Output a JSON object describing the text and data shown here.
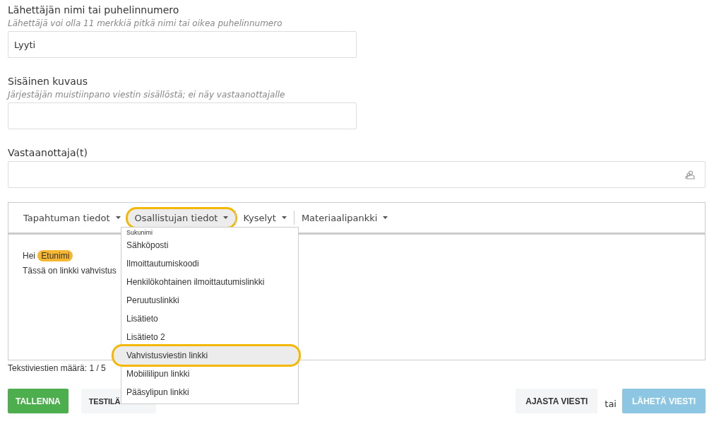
{
  "sender": {
    "label": "Lähettäjän nimi tai puhelinnumero",
    "hint": "Lähettäjä voi olla 11 merkkiä pitkä nimi tai oikea puhelinnumero",
    "value": "Lyyti"
  },
  "description": {
    "label": "Sisäinen kuvaus",
    "hint": "Järjestäjän muistiinpano viestin sisällöstä; ei näy vastaanottajalle"
  },
  "recipients": {
    "label": "Vastaanottaja(t)"
  },
  "toolbar": [
    {
      "label": "Tapahtuman tiedot",
      "selected": false
    },
    {
      "label": "Osallistujan tiedot",
      "selected": true
    },
    {
      "label": "Kyselyt",
      "selected": false
    },
    {
      "label": "Materiaalipankki",
      "selected": false
    }
  ],
  "message": {
    "greeting": "Hei",
    "tag": "Etunimi",
    "line_2": "Tässä on linkki vahvistus"
  },
  "counter": "Tekstiviestien määrä: 1 / 5",
  "menu": [
    {
      "label": "Sukunimi",
      "selected": false
    },
    {
      "label": "Sähköposti",
      "selected": false
    },
    {
      "label": "Ilmoittautumiskoodi",
      "selected": false
    },
    {
      "label": "Henkilökohtainen ilmoittautumislinkki",
      "selected": false
    },
    {
      "label": "Peruutuslinkki",
      "selected": false
    },
    {
      "label": "Lisätieto",
      "selected": false
    },
    {
      "label": "Lisätieto 2",
      "selected": false
    },
    {
      "label": "Vahvistusviestin linkki",
      "selected": true
    },
    {
      "label": "Mobiililipun linkki",
      "selected": false
    },
    {
      "label": "Pääsylipun linkki",
      "selected": false
    }
  ],
  "buttons": {
    "save": "TALLENNA",
    "test": "TESTILÄ",
    "schedule": "AJASTA VIESTI",
    "or": "tai",
    "send": {
      "label": "LÄHETÄ VIESTI",
      "disabled": true
    }
  }
}
